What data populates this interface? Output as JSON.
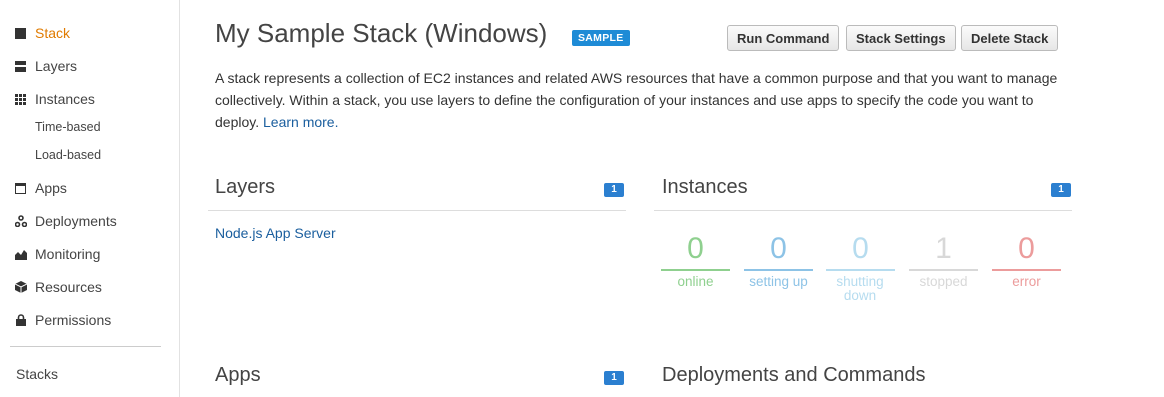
{
  "sidebar": {
    "items": [
      {
        "label": "Stack",
        "icon": "stack-icon",
        "active": true
      },
      {
        "label": "Layers",
        "icon": "layers-icon"
      },
      {
        "label": "Instances",
        "icon": "instances-grid-icon"
      },
      {
        "label": "Time-based",
        "sub": true
      },
      {
        "label": "Load-based",
        "sub": true
      },
      {
        "label": "Apps",
        "icon": "apps-icon"
      },
      {
        "label": "Deployments",
        "icon": "deployments-icon"
      },
      {
        "label": "Monitoring",
        "icon": "monitoring-icon"
      },
      {
        "label": "Resources",
        "icon": "resources-cube-icon"
      },
      {
        "label": "Permissions",
        "icon": "lock-icon"
      }
    ],
    "stacks_label": "Stacks"
  },
  "header": {
    "title": "My Sample Stack (Windows)",
    "badge": "SAMPLE",
    "buttons": {
      "run": "Run Command",
      "settings": "Stack Settings",
      "delete": "Delete Stack"
    }
  },
  "description": {
    "text": "A stack represents a collection of EC2 instances and related AWS resources that have a common purpose and that you want to manage collectively. Within a stack, you use layers to define the configuration of your instances and use apps to specify the code you want to deploy.",
    "link": "Learn more."
  },
  "layers": {
    "title": "Layers",
    "count": "1",
    "items": [
      "Node.js App Server"
    ]
  },
  "instances": {
    "title": "Instances",
    "count": "1",
    "stats": [
      {
        "value": "0",
        "label": "online",
        "color": "#8fd08f"
      },
      {
        "value": "0",
        "label": "setting up",
        "color": "#8dc3e6"
      },
      {
        "value": "0",
        "label": "shutting down",
        "color": "#b6dcef"
      },
      {
        "value": "1",
        "label": "stopped",
        "color": "#d8d8d8"
      },
      {
        "value": "0",
        "label": "error",
        "color": "#ec9c9c"
      }
    ]
  },
  "apps": {
    "title": "Apps",
    "count": "1"
  },
  "deployments": {
    "title": "Deployments and Commands"
  },
  "colors": {
    "accent": "#e07b00",
    "link": "#1a5e9e",
    "badge": "#1e8bd6",
    "count": "#2b7fd0"
  }
}
